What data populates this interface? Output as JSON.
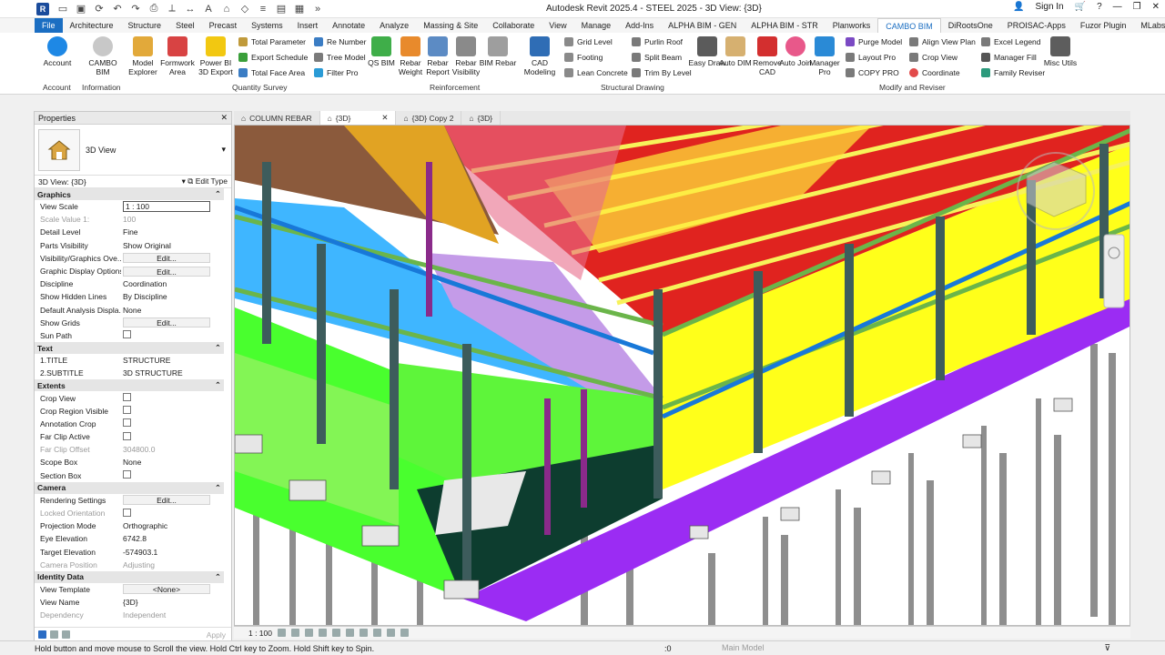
{
  "window": {
    "title": "Autodesk Revit 2025.4 - STEEL 2025 - 3D View: {3D}",
    "sign_in": "Sign In",
    "logo": "R"
  },
  "tabs": [
    "File",
    "Architecture",
    "Structure",
    "Steel",
    "Precast",
    "Systems",
    "Insert",
    "Annotate",
    "Analyze",
    "Massing & Site",
    "Collaborate",
    "View",
    "Manage",
    "Add-Ins",
    "ALPHA BIM - GEN",
    "ALPHA BIM - STR",
    "Planworks",
    "CAMBO BIM",
    "DiRootsOne",
    "PROISAC-Apps",
    "Fuzor Plugin",
    "MLabs"
  ],
  "active_tab": "CAMBO BIM",
  "ribbon": {
    "account": {
      "label": "Account",
      "group": "Account"
    },
    "cambo_info": {
      "label": "CAMBO BIM",
      "group": "Information"
    },
    "model_explorer": "Model Explorer",
    "formwork_area": "Formwork Area",
    "power_bi": "Power BI 3D Export",
    "total_parameter": "Total Parameter",
    "export_schedule": "Export Schedule",
    "total_face_area": "Total Face Area",
    "re_number": "Re Number",
    "tree_model": "Tree Model",
    "filter_pro": "Filter Pro",
    "quantity_survey": "Quantity Survey",
    "qs_bim": "QS BIM",
    "rebar_weight": "Rebar Weight",
    "rebar_report": "Rebar Report",
    "rebar_visibility": "Rebar Visibility",
    "bim_rebar": "BIM Rebar",
    "reinforcement": "Reinforcement",
    "cad_modeling": "CAD Modeling",
    "grid_level": "Grid Level",
    "footing": "Footing",
    "lean_concrete": "Lean Concrete",
    "purlin_roof": "Purlin Roof",
    "split_beam": "Split Beam",
    "trim_by_level": "Trim By Level",
    "structural_drawing": "Structural Drawing",
    "easy_draw": "Easy Draw",
    "auto_dim": "Auto DIM",
    "remove_cad": "Remove CAD",
    "auto_join": "Auto Join",
    "manager_pro": "Manager Pro",
    "purge_model": "Purge Model",
    "layout_pro": "Layout Pro",
    "copy_pro": "COPY PRO",
    "align_view_plan": "Align View Plan",
    "crop_view": "Crop View",
    "coordinate": "Coordinate",
    "excel_legend": "Excel Legend",
    "manager_fill": "Manager Fill",
    "family_reviser": "Family Reviser",
    "misc_utils": "Misc Utils",
    "modify_reviser": "Modify and Reviser"
  },
  "properties": {
    "title": "Properties",
    "type_name": "3D View",
    "instance": "3D View: {3D}",
    "edit_type": "Edit Type",
    "apply": "Apply",
    "sections": [
      {
        "name": "Graphics",
        "rows": [
          {
            "k": "View Scale",
            "v": "1 : 100",
            "kind": "input"
          },
          {
            "k": "Scale Value    1:",
            "v": "100",
            "kind": "dim"
          },
          {
            "k": "Detail Level",
            "v": "Fine"
          },
          {
            "k": "Parts Visibility",
            "v": "Show Original"
          },
          {
            "k": "Visibility/Graphics Ove...",
            "v": "Edit...",
            "kind": "button"
          },
          {
            "k": "Graphic Display Options",
            "v": "Edit...",
            "kind": "button"
          },
          {
            "k": "Discipline",
            "v": "Coordination"
          },
          {
            "k": "Show Hidden Lines",
            "v": "By Discipline"
          },
          {
            "k": "Default Analysis Displa...",
            "v": "None"
          },
          {
            "k": "Show Grids",
            "v": "Edit...",
            "kind": "button"
          },
          {
            "k": "Sun Path",
            "v": "",
            "kind": "check"
          }
        ]
      },
      {
        "name": "Text",
        "rows": [
          {
            "k": "1.TITLE",
            "v": "STRUCTURE"
          },
          {
            "k": "2.SUBTITLE",
            "v": "3D STRUCTURE"
          }
        ]
      },
      {
        "name": "Extents",
        "rows": [
          {
            "k": "Crop View",
            "v": "",
            "kind": "check"
          },
          {
            "k": "Crop Region Visible",
            "v": "",
            "kind": "check"
          },
          {
            "k": "Annotation Crop",
            "v": "",
            "kind": "check"
          },
          {
            "k": "Far Clip Active",
            "v": "",
            "kind": "check"
          },
          {
            "k": "Far Clip Offset",
            "v": "304800.0",
            "kind": "dim"
          },
          {
            "k": "Scope Box",
            "v": "None"
          },
          {
            "k": "Section Box",
            "v": "",
            "kind": "check"
          }
        ]
      },
      {
        "name": "Camera",
        "rows": [
          {
            "k": "Rendering Settings",
            "v": "Edit...",
            "kind": "button"
          },
          {
            "k": "Locked Orientation",
            "v": "",
            "kind": "checkdim"
          },
          {
            "k": "Projection Mode",
            "v": "Orthographic"
          },
          {
            "k": "Eye Elevation",
            "v": "6742.8"
          },
          {
            "k": "Target Elevation",
            "v": "-574903.1"
          },
          {
            "k": "Camera Position",
            "v": "Adjusting",
            "kind": "dim"
          }
        ]
      },
      {
        "name": "Identity Data",
        "rows": [
          {
            "k": "View Template",
            "v": "<None>",
            "kind": "button"
          },
          {
            "k": "View Name",
            "v": "{3D}"
          },
          {
            "k": "Dependency",
            "v": "Independent",
            "kind": "dim"
          }
        ]
      }
    ]
  },
  "doc_tabs": [
    {
      "label": "COLUMN REBAR",
      "active": false
    },
    {
      "label": "{3D}",
      "active": true
    },
    {
      "label": "{3D} Copy 2",
      "active": false
    },
    {
      "label": "{3D}",
      "active": false
    }
  ],
  "view_bar": {
    "scale": "1 : 100"
  },
  "status": {
    "message": "Hold button and move mouse to Scroll the view. Hold Ctrl key to Zoom. Hold Shift key to Spin.",
    "model": "Main Model",
    "count": ":0"
  }
}
